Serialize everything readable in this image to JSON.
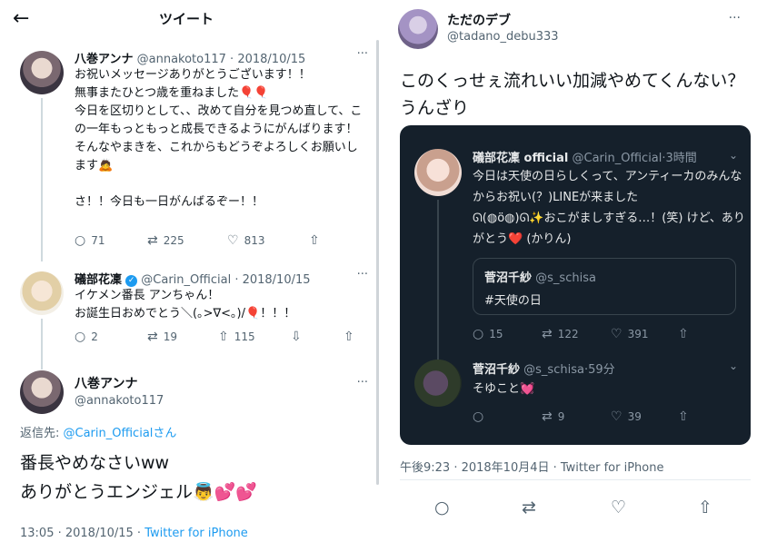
{
  "left": {
    "topbar": {
      "back_icon": "←",
      "title": "ツイート"
    },
    "tweet1": {
      "name": "八巻アンナ",
      "handle": "@annakoto117",
      "date": "2018/10/15",
      "text": "お祝いメッセージありがとうございます！！\n無事またひとつ歳を重ねました🎈🎈\n今日を区切りとして、、改めて自分を見つめ直して、この一年もっともっと成長できるようにがんばります！\nそんなやまきを、これからもどうぞよろしくお願いします🙇\n\nさ！！今日も一日がんばるぞー！！",
      "replies": "71",
      "retweets": "225",
      "likes": "813"
    },
    "tweet2": {
      "name": "礒部花凜",
      "handle": "@Carin_Official",
      "date": "2018/10/15",
      "text": "イケメン番長 アンちゃん！\nお誕生日おめでとう＼(｡>∇<｡)/🎈！！！",
      "replies": "2",
      "retweets": "19",
      "likes": "115"
    },
    "main_tweet": {
      "name": "八巻アンナ",
      "handle": "@annakoto117",
      "replying_to_prefix": "返信先: ",
      "replying_to_handle": "@Carin_Official",
      "replying_to_suffix": "さん",
      "text": "番長やめなさいww\nありがとうエンジェル👼💕💕",
      "time": "13:05 · 2018/10/15 · ",
      "source": "Twitter for iPhone"
    }
  },
  "right": {
    "name": "ただのデブ",
    "handle": "@tadano_debu333",
    "text": "このくっせぇ流れいい加減やめてくんない？うんざり",
    "embedded": {
      "tweet1": {
        "name": "礒部花凜 official",
        "handle": "@Carin_Official",
        "time": "3時間",
        "text": "今日は天使の日らしくって、アンティーカのみんなからお祝い(？)LINEが来ました\nᘏ(◍ö◍)ᘏ✨おこがましすぎる…！(笑) けど、ありがとう❤️ (かりん)",
        "quote": {
          "name": "菅沼千紗",
          "handle": "@s_schisa",
          "text": "#天使の日"
        },
        "replies": "15",
        "retweets": "122",
        "likes": "391"
      },
      "tweet2": {
        "name": "菅沼千紗",
        "handle": "@s_schisa",
        "time": "59分",
        "text": "そゆこと💓",
        "retweets": "9",
        "likes": "39"
      }
    },
    "timestamp": "午後9:23 · 2018年10月4日 · Twitter for iPhone"
  },
  "icons": {
    "reply": "reply-icon",
    "retweet": "retweet-icon",
    "like": "heart-icon",
    "share": "share-icon",
    "more": "more-icon"
  },
  "colors": {
    "accent": "#1d9bf0",
    "dark_bg": "#15202b",
    "muted": "#536471"
  }
}
